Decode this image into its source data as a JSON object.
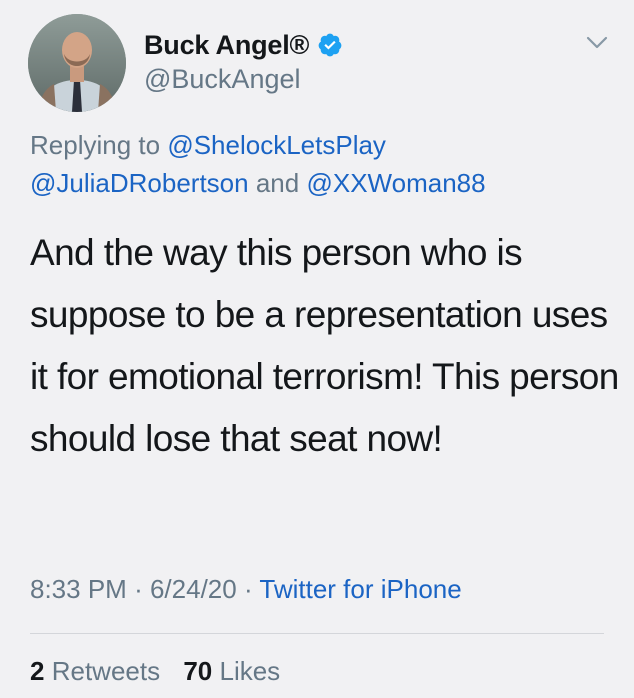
{
  "author": {
    "display_name": "Buck Angel®",
    "handle": "@BuckAngel",
    "verified_icon": "verified-badge-icon",
    "avatar": "profile-avatar"
  },
  "menu": {
    "icon": "chevron-down-icon"
  },
  "reply": {
    "prefix": "Replying to",
    "mentions": [
      "@ShelockLetsPlay",
      "@JuliaDRobertson",
      "@XXWoman88"
    ],
    "conjunction": "and"
  },
  "tweet": {
    "text": "And the way this person who is suppose to be a representation uses it for emotional terrorism! This person should lose that seat now!"
  },
  "meta": {
    "time": "8:33 PM",
    "separator": "·",
    "date": "6/24/20",
    "source": "Twitter for iPhone"
  },
  "stats": {
    "retweets_count": "2",
    "retweets_label": "Retweets",
    "likes_count": "70",
    "likes_label": "Likes"
  },
  "colors": {
    "background": "#f1f1f3",
    "text": "#14171a",
    "secondary": "#657786",
    "link": "#1b64c4",
    "verified": "#1da1f2"
  }
}
